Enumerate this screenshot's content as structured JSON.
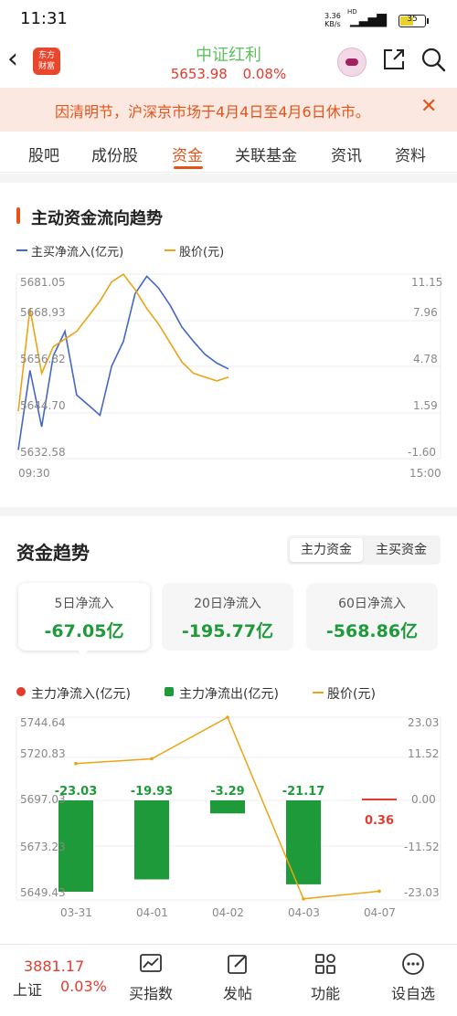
{
  "status_bar": {
    "time": "11:31",
    "net_speed": "3.36",
    "net_unit": "KB/s",
    "net_type": "HD",
    "battery": "35"
  },
  "header": {
    "logo_line1": "东方",
    "logo_line2": "财富",
    "title": "中证红利",
    "price": "5653.98",
    "change": "0.08%",
    "icons": [
      "back-arrow-icon",
      "share-icon",
      "search-icon"
    ]
  },
  "notice": {
    "text": "因清明节，沪深京市场于4月4日至4月6日休市。",
    "close": "✕"
  },
  "tabs": [
    {
      "label": "股吧"
    },
    {
      "label": "成份股"
    },
    {
      "label": "资金",
      "active": true
    },
    {
      "label": "关联基金"
    },
    {
      "label": "资讯"
    },
    {
      "label": "资料"
    }
  ],
  "colors": {
    "accent": "#e3541b",
    "up": "#e23b2f",
    "down": "#1f9a3a",
    "flow_line": "#4467c4",
    "price_line": "#eba415"
  },
  "flow_section": {
    "title": "主动资金流向趋势",
    "legend_flow": "主买净流入(亿元)",
    "legend_price": "股价(元)",
    "left_ticks": [
      "5681.05",
      "5668.93",
      "5656.82",
      "5644.70",
      "5632.58"
    ],
    "right_ticks": [
      "11.15",
      "7.96",
      "4.78",
      "1.59",
      "-1.60"
    ],
    "x_start": "09:30",
    "x_end": "15:00"
  },
  "trend_section": {
    "title": "资金趋势",
    "toggle": [
      "主力资金",
      "主买资金"
    ],
    "toggle_active": 0,
    "cards": [
      {
        "label": "5日净流入",
        "value": "-67.05亿"
      },
      {
        "label": "20日净流入",
        "value": "-195.77亿"
      },
      {
        "label": "60日净流入",
        "value": "-568.86亿"
      }
    ],
    "legend": [
      "主力净流入(亿元)",
      "主力净流出(亿元)",
      "股价(元)"
    ],
    "left_ticks": [
      "5744.64",
      "5720.83",
      "5697.03",
      "5673.23",
      "5649.43"
    ],
    "right_ticks": [
      "23.03",
      "11.52",
      "0.00",
      "-11.52",
      "-23.03"
    ],
    "bar_labels": [
      "-23.03",
      "-19.93",
      "-3.29",
      "-21.17",
      "0.36"
    ]
  },
  "chart_data": [
    {
      "type": "line",
      "title": "主动资金流向趋势",
      "x_range": [
        "09:30",
        "15:00"
      ],
      "series": [
        {
          "name": "主买净流入(亿元)",
          "axis": "right",
          "ylim": [
            -1.6,
            11.15
          ],
          "values": [
            -1.0,
            4.5,
            0.6,
            5.5,
            7.2,
            2.8,
            2.1,
            1.4,
            4.8,
            6.5,
            9.8,
            11.0,
            10.2,
            9.0,
            7.5,
            6.5,
            5.6,
            5.0,
            4.6
          ]
        },
        {
          "name": "股价(元)",
          "axis": "left",
          "ylim": [
            5632.58,
            5681.05
          ],
          "values": [
            5645.0,
            5672.0,
            5655.0,
            5662.0,
            5664.0,
            5666.0,
            5670.0,
            5674.0,
            5679.0,
            5681.0,
            5677.0,
            5672.0,
            5668.0,
            5663.0,
            5658.0,
            5655.0,
            5654.0,
            5653.0,
            5654.0
          ]
        }
      ]
    },
    {
      "type": "bar",
      "title": "资金趋势",
      "categories": [
        "03-31",
        "04-01",
        "04-02",
        "04-03",
        "04-07"
      ],
      "series": [
        {
          "name": "主力净流入/流出(亿元)",
          "axis": "right",
          "ylim": [
            -23.03,
            23.03
          ],
          "values": [
            -23.03,
            -19.93,
            -3.29,
            -21.17,
            0.36
          ]
        },
        {
          "name": "股价(元)",
          "axis": "left",
          "ylim": [
            5649.43,
            5744.64
          ],
          "values": [
            5720.5,
            5723.0,
            5744.6,
            5650.0,
            5653.98
          ]
        }
      ]
    }
  ],
  "bottom_bar": {
    "index_value": "3881.17",
    "index_name": "上证",
    "index_change": "0.03%",
    "nav": [
      {
        "label": "买指数",
        "icon": "chart-icon"
      },
      {
        "label": "发帖",
        "icon": "edit-icon"
      },
      {
        "label": "功能",
        "icon": "grid-icon"
      },
      {
        "label": "设自选",
        "icon": "more-icon"
      }
    ]
  }
}
